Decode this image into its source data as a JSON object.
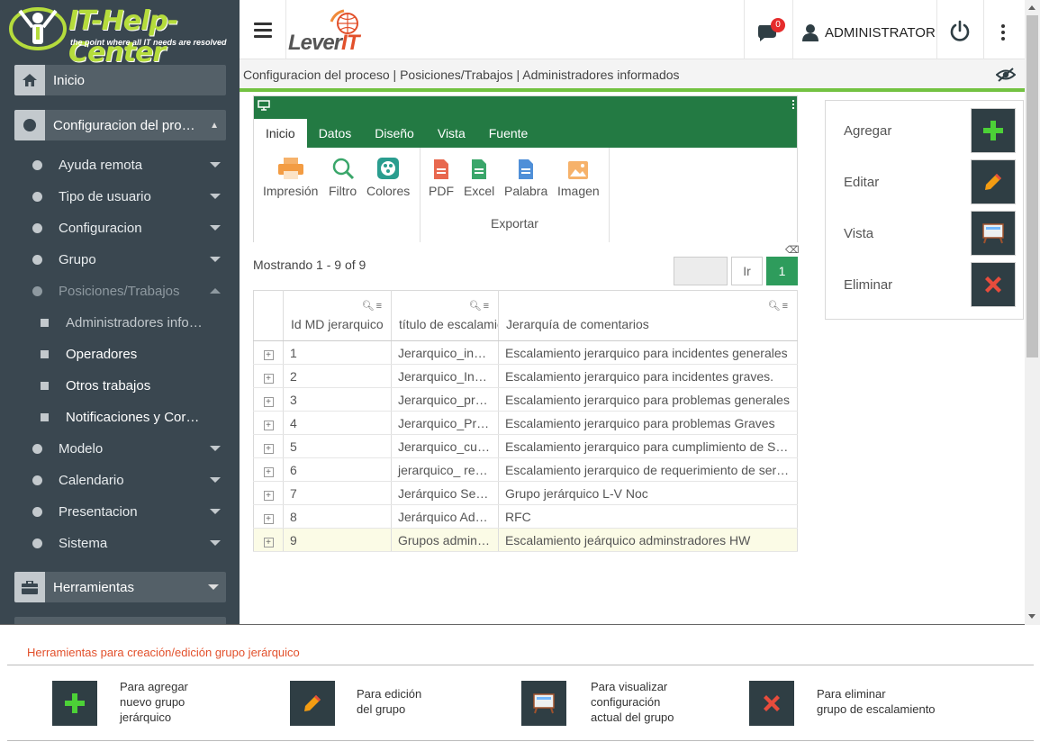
{
  "brand": {
    "name": "IT-Help-Center",
    "tagline": "the point where all IT needs are resolved",
    "lever": "Lever",
    "lever_it": "IT"
  },
  "sidebar": {
    "inicio": "Inicio",
    "config": "Configuracion del proceso",
    "subs": [
      "Ayuda remota",
      "Tipo de usuario",
      "Configuracion",
      "Grupo",
      "Posiciones/Trabajos"
    ],
    "subs2": [
      "Administradores informados",
      "Operadores",
      "Otros trabajos",
      "Notificaciones y Correos"
    ],
    "subs3": [
      "Modelo",
      "Calendario",
      "Presentacion",
      "Sistema"
    ],
    "herramientas": "Herramientas"
  },
  "topbar": {
    "badge": "0",
    "user": "ADMINISTRATOR"
  },
  "breadcrumb": "Configuracion del proceso | Posiciones/Trabajos | Administradores informados",
  "ribbon": {
    "tabs": [
      "Inicio",
      "Datos",
      "Diseño",
      "Vista",
      "Fuente"
    ],
    "tools": [
      "Impresión",
      "Filtro",
      "Colores"
    ],
    "export_tools": [
      "PDF",
      "Excel",
      "Palabra",
      "Imagen"
    ],
    "export_label": "Exportar"
  },
  "pager": {
    "showing": "Mostrando 1 - 9 of 9",
    "go": "Ir",
    "page": "1"
  },
  "table": {
    "headers": [
      "Id MD jerarquico",
      "título de escalamiento",
      "Jerarquía de comentarios"
    ],
    "rows": [
      [
        "1",
        "Jerarquico_incidentes",
        "Escalamiento jerarquico para incidentes generales"
      ],
      [
        "2",
        "Jerarquico_Incidentes graves",
        "Escalamiento jerarquico para incidentes graves."
      ],
      [
        "3",
        "Jerarquico_problemas",
        "Escalamiento jerarquico para problemas generales"
      ],
      [
        "4",
        "Jerarquico_Problemas graves",
        "Escalamiento jerarquico para problemas Graves"
      ],
      [
        "5",
        "Jerarquico_cumplimiento",
        "Escalamiento jerarquico para cumplimiento de SLA"
      ],
      [
        "6",
        "jerarquico_ requerimiento",
        "Escalamiento jerarquico de requerimiento de servicio"
      ],
      [
        "7",
        "Jerárquico Servicios",
        "Grupo jerárquico L-V Noc"
      ],
      [
        "8",
        "Jerárquico Administradores",
        "RFC"
      ],
      [
        "9",
        "Grupos administradores",
        "Escalamiento jeárquico adminstradores HW"
      ]
    ]
  },
  "actions": {
    "add": "Agregar",
    "edit": "Editar",
    "view": "Vista",
    "delete": "Eliminar"
  },
  "legend": {
    "title": "Herramientas para creación/edición grupo jerárquico",
    "add": [
      "Para agregar",
      "nuevo grupo",
      "jerárquico"
    ],
    "edit": [
      "Para edición",
      "del grupo"
    ],
    "view": [
      "Para visualizar",
      "configuración",
      "actual del grupo"
    ],
    "delete": [
      "Para eliminar",
      "grupo de escalamiento"
    ]
  },
  "colors": {
    "green": "#237a43",
    "accent": "#73c241",
    "sidebar": "#3a4750",
    "orange": "#e2502b"
  }
}
